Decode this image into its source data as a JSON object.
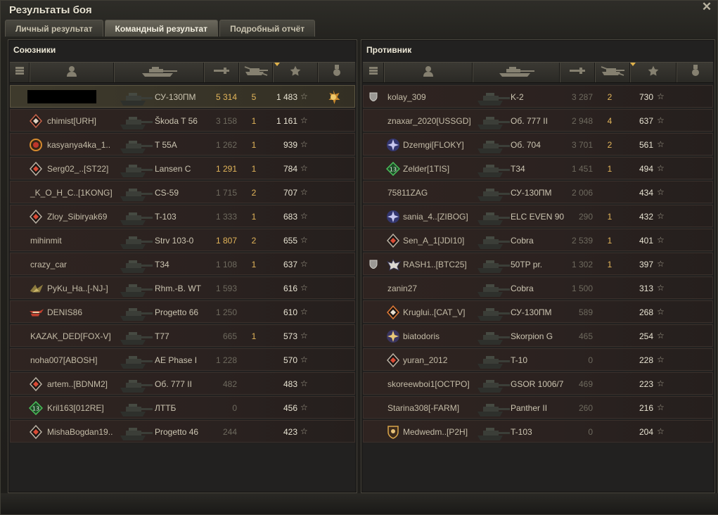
{
  "window": {
    "title": "Результаты боя",
    "close_icon": "close-icon"
  },
  "tabs": [
    {
      "label": "Личный результат",
      "active": false
    },
    {
      "label": "Командный результат",
      "active": true
    },
    {
      "label": "Подробный отчёт",
      "active": false
    }
  ],
  "allies": {
    "title": "Союзники",
    "columns": [
      "platoon-icon",
      "player-icon",
      "vehicle-icon",
      "damage-icon",
      "kills-icon",
      "xp-star-icon",
      "medal-icon"
    ],
    "rows": [
      {
        "name": "",
        "redacted": true,
        "badge": "",
        "vehicle": "СУ-130ПМ",
        "damage": "5 314",
        "dmg_hi": true,
        "kills": "5",
        "xp": "1 483",
        "medal": true,
        "me": true
      },
      {
        "name": "chimist[URH]",
        "badge": "diamond",
        "vehicle": "Škoda T 56",
        "damage": "3 158",
        "kills": "1",
        "xp": "1 161"
      },
      {
        "name": "kasyanya4ka_1..",
        "badge": "ring",
        "vehicle": "T 55A",
        "damage": "1 262",
        "kills": "1",
        "xp": "939"
      },
      {
        "name": "Serg02_..[ST22]",
        "badge": "diamond-white",
        "vehicle": "Lansen C",
        "damage": "1 291",
        "dmg_hi": true,
        "kills": "1",
        "xp": "784"
      },
      {
        "name": "_K_O_H_C..[1KONG]",
        "badge": "",
        "vehicle": "CS-59",
        "damage": "1 715",
        "kills": "2",
        "xp": "707"
      },
      {
        "name": "Zloy_Sibiryak69",
        "badge": "diamond-white",
        "vehicle": "T-103",
        "damage": "1 333",
        "kills": "1",
        "xp": "683"
      },
      {
        "name": "mihinmit",
        "badge": "",
        "vehicle": "Strv 103-0",
        "damage": "1 807",
        "dmg_hi": true,
        "kills": "2",
        "xp": "655"
      },
      {
        "name": "crazy_car",
        "badge": "",
        "vehicle": "T34",
        "damage": "1 108",
        "kills": "1",
        "xp": "637"
      },
      {
        "name": "PyKu_Ha..[-NJ-]",
        "badge": "wings",
        "vehicle": "Rhm.-B. WT",
        "damage": "1 593",
        "kills": "",
        "xp": "616"
      },
      {
        "name": "DENIS86",
        "badge": "red-wings",
        "vehicle": "Progetto 66",
        "damage": "1 250",
        "kills": "",
        "xp": "610"
      },
      {
        "name": "KAZAK_DED[FOX-V]",
        "badge": "",
        "vehicle": "T77",
        "damage": "665",
        "kills": "1",
        "xp": "573"
      },
      {
        "name": "noha007[ABOSH]",
        "badge": "",
        "vehicle": "AE Phase I",
        "damage": "1 228",
        "kills": "",
        "xp": "570"
      },
      {
        "name": "artem..[BDNM2]",
        "badge": "diamond-white",
        "vehicle": "Об. 777 II",
        "damage": "482",
        "kills": "",
        "xp": "483"
      },
      {
        "name": "Kril163[012RE]",
        "badge": "green-13",
        "vehicle": "ЛТТБ",
        "damage": "0",
        "kills": "",
        "xp": "456"
      },
      {
        "name": "MishaBogdan19..",
        "badge": "diamond-white",
        "vehicle": "Progetto 46",
        "damage": "244",
        "kills": "",
        "xp": "423"
      }
    ]
  },
  "enemies": {
    "title": "Противник",
    "rows": [
      {
        "name": "kolay_309",
        "platoon": true,
        "badge": "",
        "vehicle": "K-2",
        "damage": "3 287",
        "kills": "2",
        "xp": "730"
      },
      {
        "name": "znaxar_2020[USSGD]",
        "badge": "",
        "vehicle": "Об. 777 II",
        "damage": "2 948",
        "kills": "4",
        "xp": "637"
      },
      {
        "name": "Dzemgi[FLOKY]",
        "badge": "blue-star",
        "vehicle": "Об. 704",
        "damage": "3 701",
        "kills": "2",
        "xp": "561"
      },
      {
        "name": "Zelder[1TIS]",
        "badge": "green-13",
        "vehicle": "T34",
        "damage": "1 451",
        "kills": "1",
        "xp": "494"
      },
      {
        "name": "75811ZAG",
        "badge": "",
        "vehicle": "СУ-130ПМ",
        "damage": "2 006",
        "kills": "",
        "xp": "434"
      },
      {
        "name": "sania_4..[ZIBOG]",
        "badge": "blue-star",
        "vehicle": "ELC EVEN 90",
        "damage": "290",
        "kills": "1",
        "xp": "432"
      },
      {
        "name": "Sen_A_1[JDI10]",
        "badge": "diamond-white",
        "vehicle": "Cobra",
        "damage": "2 539",
        "kills": "1",
        "xp": "401"
      },
      {
        "name": "RASH1..[BTC25]",
        "platoon": true,
        "badge": "tiger",
        "vehicle": "50TP pr.",
        "damage": "1 302",
        "kills": "1",
        "xp": "397"
      },
      {
        "name": "zanin27",
        "badge": "",
        "vehicle": "Cobra",
        "damage": "1 500",
        "kills": "",
        "xp": "313"
      },
      {
        "name": "Kruglui..[CAT_V]",
        "badge": "diamond-orange",
        "vehicle": "СУ-130ПМ",
        "damage": "589",
        "kills": "",
        "xp": "268"
      },
      {
        "name": "biatodoris",
        "badge": "gold-star",
        "vehicle": "Skorpion G",
        "damage": "465",
        "kills": "",
        "xp": "254"
      },
      {
        "name": "yuran_2012",
        "badge": "diamond-white",
        "vehicle": "T-10",
        "damage": "0",
        "kills": "",
        "xp": "228"
      },
      {
        "name": "skoreewboi1[OCTPO]",
        "badge": "",
        "vehicle": "GSOR 1006/7",
        "damage": "469",
        "kills": "",
        "xp": "223"
      },
      {
        "name": "Starina308[-FARM]",
        "badge": "",
        "vehicle": "Panther II",
        "damage": "260",
        "kills": "",
        "xp": "216"
      },
      {
        "name": "Medwedm..[P2H]",
        "badge": "shield-gold",
        "vehicle": "T-103",
        "damage": "0",
        "kills": "",
        "xp": "204"
      }
    ]
  },
  "star_glyph": "☆"
}
